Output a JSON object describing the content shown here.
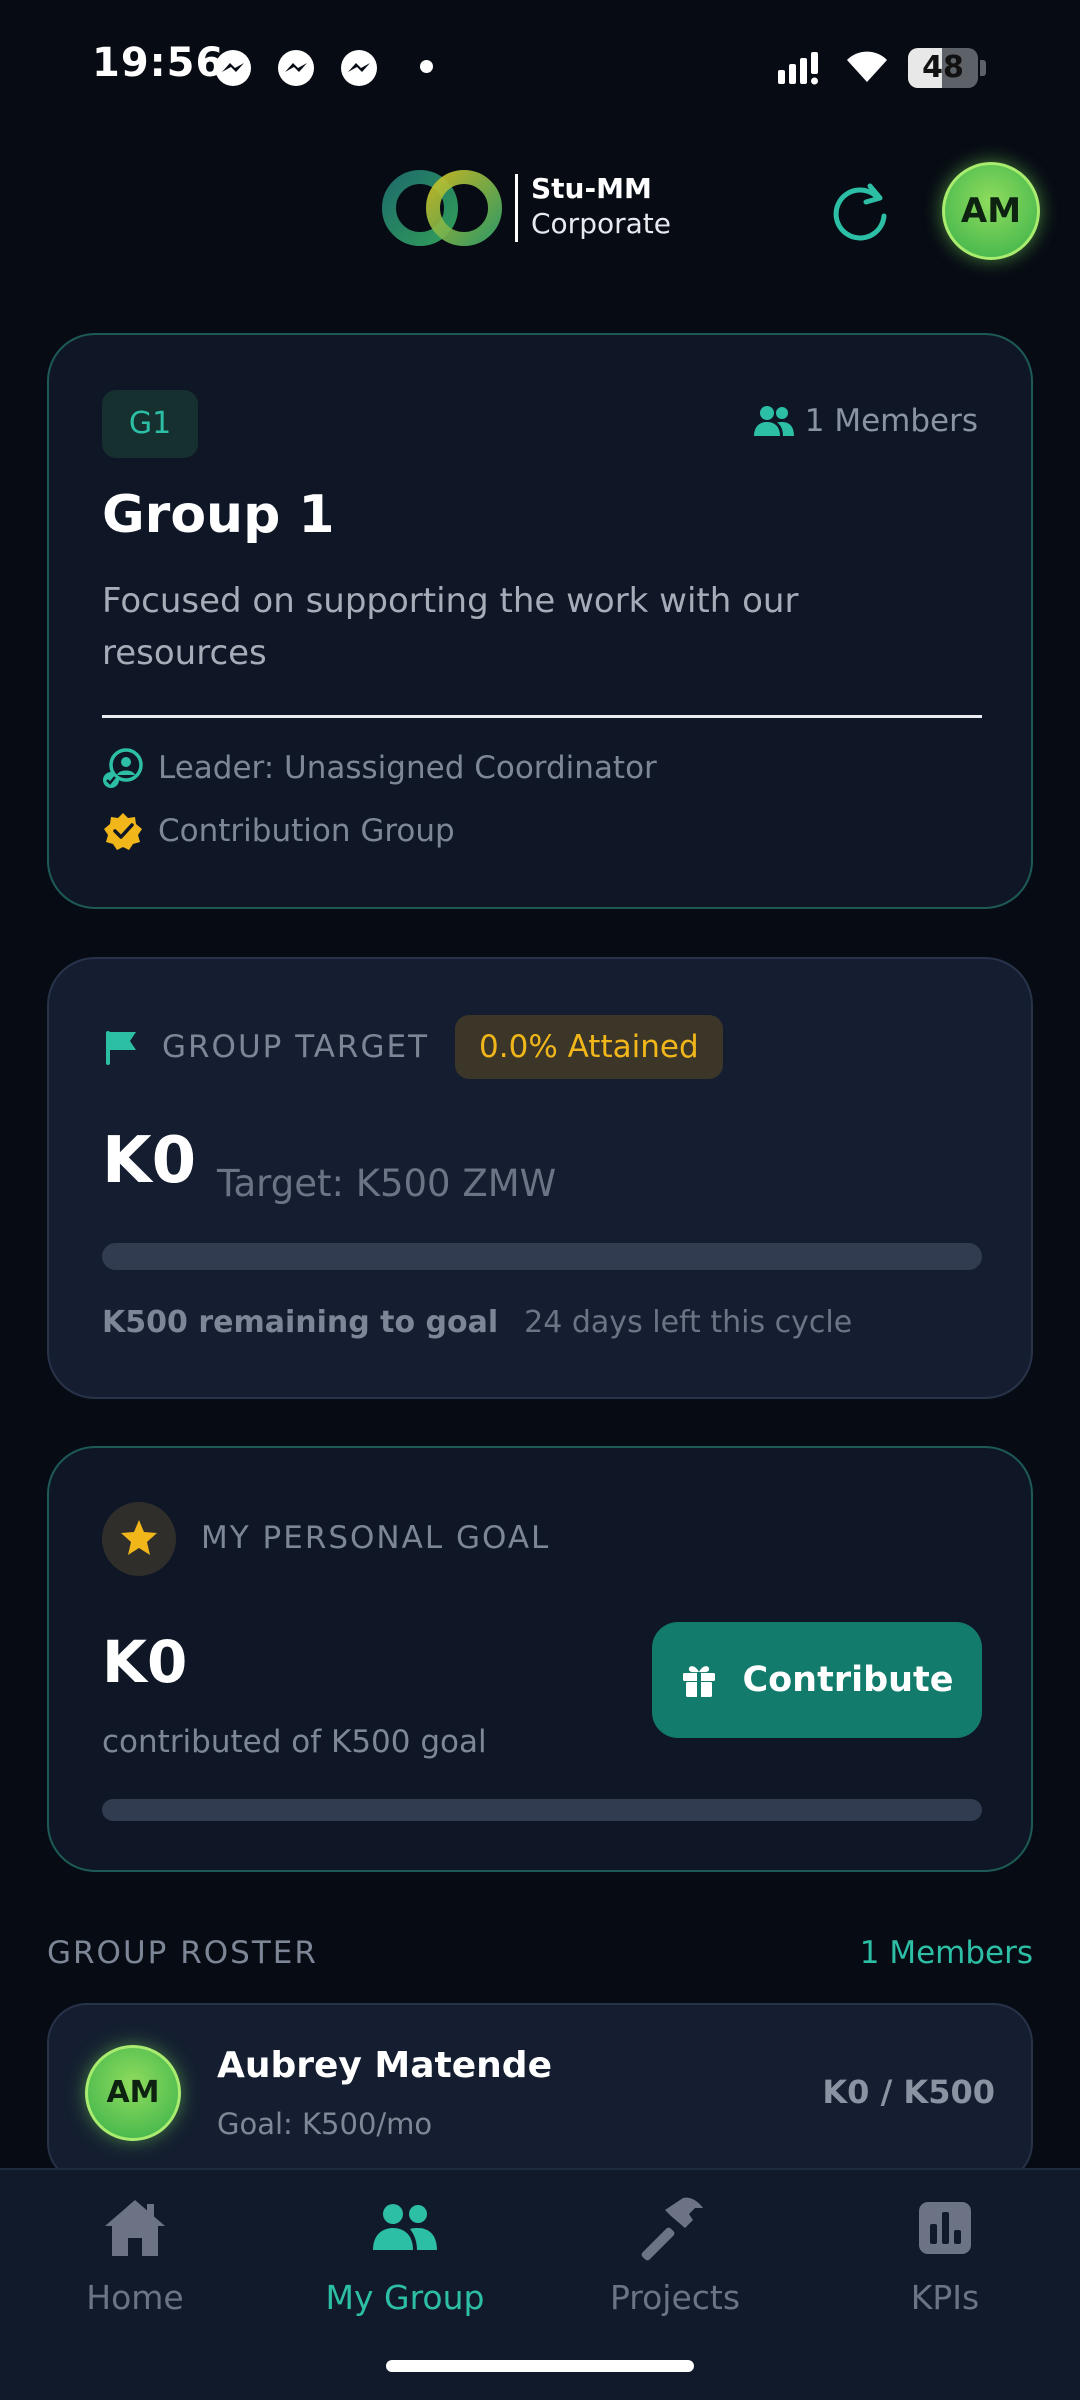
{
  "status_bar": {
    "time": "19:56",
    "battery": "48",
    "battery_level": 0.48,
    "icons": [
      "messenger-icon",
      "messenger-icon",
      "messenger-icon",
      "notification-dot",
      "signal-icon",
      "wifi-icon",
      "battery-icon"
    ]
  },
  "header": {
    "brand_name": "Stu-MM",
    "brand_sub": "Corporate",
    "avatar_initials": "AM"
  },
  "group": {
    "badge": "G1",
    "members": "1 Members",
    "title": "Group 1",
    "description": "Focused on supporting the work with our resources",
    "leader": "Leader: Unassigned Coordinator",
    "type": "Contribution Group"
  },
  "group_target": {
    "label": "GROUP TARGET",
    "attained": "0.0% Attained",
    "amount": "K0",
    "target": "Target: K500 ZMW",
    "progress": 0.0,
    "remaining": "K500 remaining to goal",
    "days_left": "24 days left this cycle"
  },
  "personal_goal": {
    "label": "MY PERSONAL GOAL",
    "amount": "K0",
    "of_goal": "contributed of K500 goal",
    "contribute_label": "Contribute",
    "progress": 0.0
  },
  "roster": {
    "label": "GROUP ROSTER",
    "count": "1 Members",
    "members": [
      {
        "initials": "AM",
        "name": "Aubrey Matende",
        "goal": "Goal: K500/mo",
        "progress": "K0 / K500"
      }
    ]
  },
  "nav": {
    "items": [
      {
        "label": "Home",
        "icon": "home-icon"
      },
      {
        "label": "My Group",
        "icon": "group-icon"
      },
      {
        "label": "Projects",
        "icon": "hammer-icon"
      },
      {
        "label": "KPIs",
        "icon": "chart-icon"
      }
    ],
    "active": "My Group"
  },
  "colors": {
    "background": "#070c14",
    "card": "#0f1727",
    "accent": "#2dbfa6",
    "warning": "#f0b61a",
    "button": "#127b6c"
  }
}
